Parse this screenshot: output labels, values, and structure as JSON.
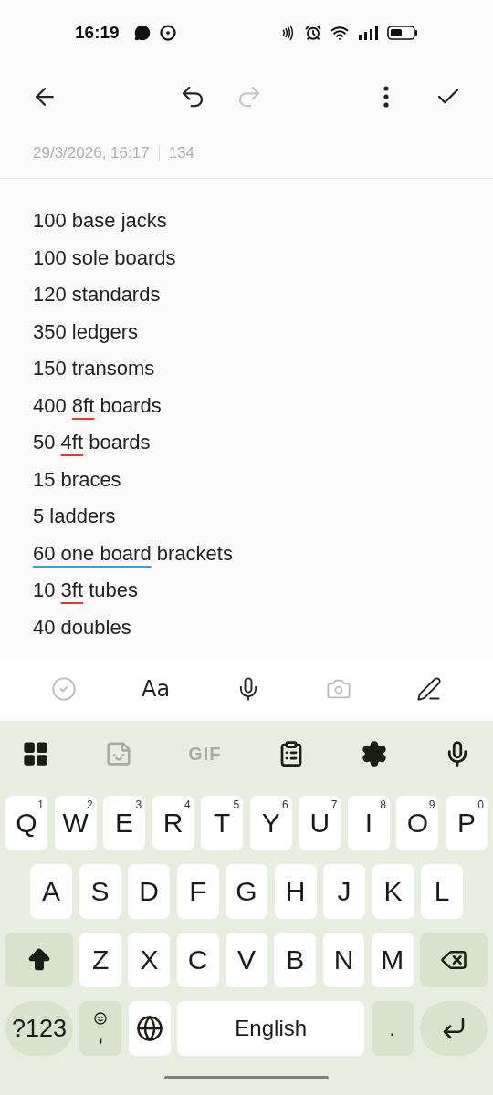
{
  "status_bar": {
    "time": "16:19"
  },
  "toolbar": {
    "items": [
      {
        "kind": "back",
        "disabled": false
      },
      {
        "kind": "undo",
        "disabled": false
      },
      {
        "kind": "redo",
        "disabled": true
      },
      {
        "kind": "more",
        "disabled": false
      },
      {
        "kind": "done",
        "disabled": false
      }
    ]
  },
  "note": {
    "date": "29/3/2026, 16:17",
    "count": "134",
    "lines": [
      {
        "parts": [
          {
            "text": "100 base jacks",
            "kind": "plain"
          }
        ]
      },
      {
        "parts": [
          {
            "text": "100 sole boards",
            "kind": "plain"
          }
        ]
      },
      {
        "parts": [
          {
            "text": "120 standards",
            "kind": "plain"
          }
        ]
      },
      {
        "parts": [
          {
            "text": "350 ledgers",
            "kind": "plain"
          }
        ]
      },
      {
        "parts": [
          {
            "text": "150 transoms",
            "kind": "plain"
          }
        ]
      },
      {
        "parts": [
          {
            "text": "400 ",
            "kind": "plain"
          },
          {
            "text": "8ft",
            "kind": "misspelled"
          },
          {
            "text": " boards",
            "kind": "plain"
          }
        ]
      },
      {
        "parts": [
          {
            "text": "50 ",
            "kind": "plain"
          },
          {
            "text": "4ft",
            "kind": "misspelled"
          },
          {
            "text": " boards",
            "kind": "plain"
          }
        ]
      },
      {
        "parts": [
          {
            "text": "15 braces",
            "kind": "plain"
          }
        ]
      },
      {
        "parts": [
          {
            "text": "5 ladders",
            "kind": "plain"
          }
        ]
      },
      {
        "parts": [
          {
            "text": "60 one board",
            "kind": "suggestion"
          },
          {
            "text": " brackets",
            "kind": "plain"
          }
        ]
      },
      {
        "parts": [
          {
            "text": "10 ",
            "kind": "plain"
          },
          {
            "text": "3ft",
            "kind": "misspelled"
          },
          {
            "text": " tubes",
            "kind": "plain"
          }
        ]
      },
      {
        "parts": [
          {
            "text": "40 doubles",
            "kind": "plain"
          }
        ]
      }
    ]
  },
  "format_bar": {
    "items": [
      {
        "kind": "checklist",
        "disabled": true
      },
      {
        "kind": "text-style",
        "label": "Aa",
        "disabled": false
      },
      {
        "kind": "voice-text",
        "disabled": false
      },
      {
        "kind": "camera",
        "disabled": true
      },
      {
        "kind": "handwriting",
        "disabled": false
      }
    ]
  },
  "keyboard": {
    "strip": [
      {
        "kind": "apps",
        "disabled": false
      },
      {
        "kind": "sticker",
        "disabled": true
      },
      {
        "kind": "gif",
        "label": "GIF",
        "disabled": true
      },
      {
        "kind": "clipboard",
        "disabled": false
      },
      {
        "kind": "settings",
        "disabled": false
      },
      {
        "kind": "voice",
        "disabled": false
      }
    ],
    "rows": [
      {
        "keys": [
          {
            "kind": "letter",
            "label": "Q",
            "hint": "1"
          },
          {
            "kind": "letter",
            "label": "W",
            "hint": "2"
          },
          {
            "kind": "letter",
            "label": "E",
            "hint": "3"
          },
          {
            "kind": "letter",
            "label": "R",
            "hint": "4"
          },
          {
            "kind": "letter",
            "label": "T",
            "hint": "5"
          },
          {
            "kind": "letter",
            "label": "Y",
            "hint": "6"
          },
          {
            "kind": "letter",
            "label": "U",
            "hint": "7"
          },
          {
            "kind": "letter",
            "label": "I",
            "hint": "8"
          },
          {
            "kind": "letter",
            "label": "O",
            "hint": "9"
          },
          {
            "kind": "letter",
            "label": "P",
            "hint": "0"
          }
        ]
      },
      {
        "keys": [
          {
            "kind": "letter",
            "label": "A"
          },
          {
            "kind": "letter",
            "label": "S"
          },
          {
            "kind": "letter",
            "label": "D"
          },
          {
            "kind": "letter",
            "label": "F"
          },
          {
            "kind": "letter",
            "label": "G"
          },
          {
            "kind": "letter",
            "label": "H"
          },
          {
            "kind": "letter",
            "label": "J"
          },
          {
            "kind": "letter",
            "label": "K"
          },
          {
            "kind": "letter",
            "label": "L"
          }
        ]
      },
      {
        "keys": [
          {
            "kind": "shift"
          },
          {
            "kind": "letter",
            "label": "Z"
          },
          {
            "kind": "letter",
            "label": "X"
          },
          {
            "kind": "letter",
            "label": "C"
          },
          {
            "kind": "letter",
            "label": "V"
          },
          {
            "kind": "letter",
            "label": "B"
          },
          {
            "kind": "letter",
            "label": "N"
          },
          {
            "kind": "letter",
            "label": "M"
          },
          {
            "kind": "backspace"
          }
        ]
      },
      {
        "keys": [
          {
            "kind": "symbols",
            "label": "?123"
          },
          {
            "kind": "emoji",
            "label": ","
          },
          {
            "kind": "globe"
          },
          {
            "kind": "space",
            "label": "English"
          },
          {
            "kind": "period",
            "label": "."
          },
          {
            "kind": "enter"
          }
        ]
      }
    ]
  }
}
